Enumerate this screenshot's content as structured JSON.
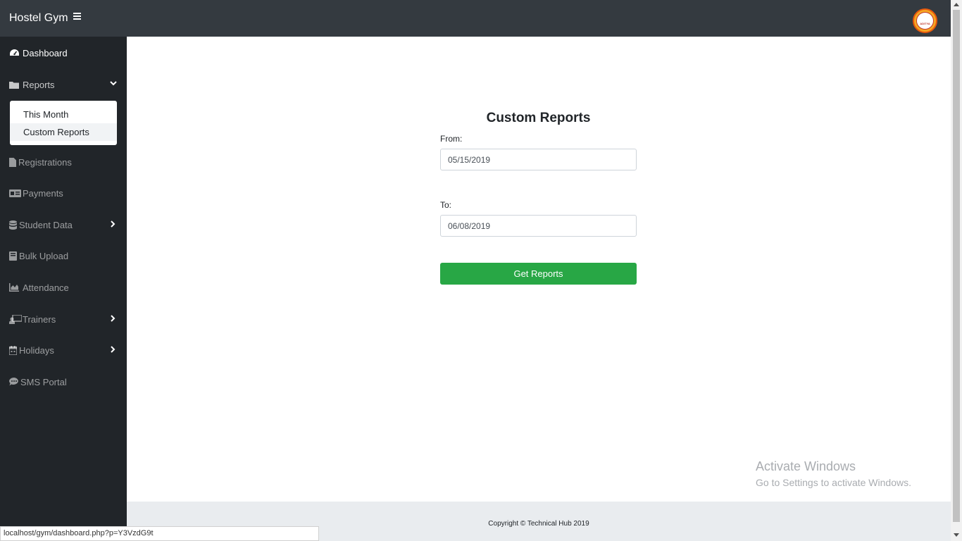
{
  "app": {
    "brand": "Hostel Gym",
    "logo_text": "ADITYA"
  },
  "sidebar": {
    "items": [
      {
        "label": "Dashboard",
        "icon": "tachometer-icon"
      },
      {
        "label": "Reports",
        "icon": "folder-icon"
      },
      {
        "label": "Registrations",
        "icon": "file-icon"
      },
      {
        "label": "Payments",
        "icon": "id-card-icon"
      },
      {
        "label": "Student Data",
        "icon": "database-icon"
      },
      {
        "label": "Bulk Upload",
        "icon": "book-icon"
      },
      {
        "label": "Attendance",
        "icon": "area-chart-icon"
      },
      {
        "label": "Trainers",
        "icon": "chalkboard-teacher-icon"
      },
      {
        "label": "Holidays",
        "icon": "calendar-icon"
      },
      {
        "label": "SMS Portal",
        "icon": "comment-dots-icon"
      }
    ],
    "reports_submenu": [
      "This Month",
      "Custom Reports"
    ]
  },
  "form": {
    "title": "Custom Reports",
    "from_label": "From:",
    "from_value": "05/15/2019",
    "to_label": "To:",
    "to_value": "06/08/2019",
    "submit_label": "Get Reports"
  },
  "watermark": {
    "line1": "Activate Windows",
    "line2": "Go to Settings to activate Windows."
  },
  "footer": {
    "text": "Copyright © Technical Hub 2019"
  },
  "status_bar": {
    "url": "localhost/gym/dashboard.php?p=Y3VzdG9t"
  }
}
